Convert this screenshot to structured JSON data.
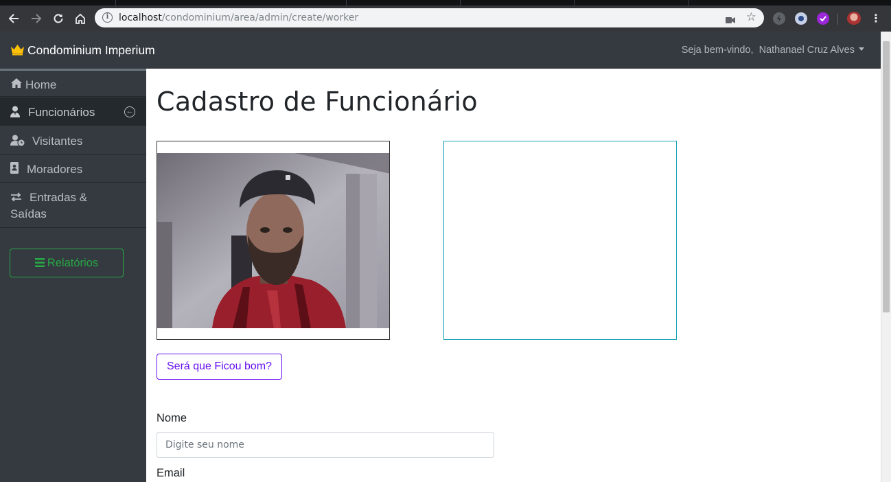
{
  "browser": {
    "url_host": "localhost",
    "url_path": "/condominium/area/admin/create/worker"
  },
  "navbar": {
    "brand": "Condominium Imperium",
    "welcome_prefix": "Seja bem-vindo,",
    "user_name": "Nathanael Cruz Alves"
  },
  "sidebar": {
    "items": [
      {
        "label": "Home",
        "icon": "home-icon"
      },
      {
        "label": "Funcionários",
        "icon": "user-tie-icon",
        "active": true
      },
      {
        "label": "Visitantes",
        "icon": "user-clock-icon"
      },
      {
        "label": "Moradores",
        "icon": "address-book-icon"
      },
      {
        "label": "Entradas &",
        "label2": "Saídas",
        "icon": "exchange-icon"
      }
    ],
    "reports_button": "Relatórios"
  },
  "main": {
    "title": "Cadastro de Funcionário",
    "check_button": "Será que Ficou bom?",
    "name_label": "Nome",
    "name_placeholder": "Digite seu nome",
    "email_label": "Email"
  },
  "colors": {
    "navbar_bg": "#343a40",
    "success": "#28a745",
    "indigo": "#6610f2",
    "info": "#17a2b8",
    "crown": "#ffc107"
  }
}
